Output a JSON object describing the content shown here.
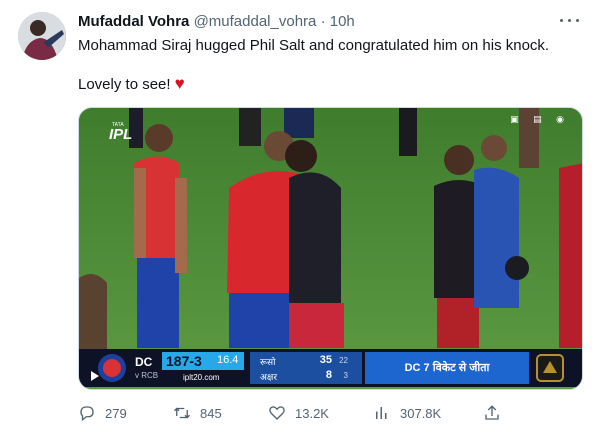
{
  "tweet": {
    "author_name": "Mufaddal Vohra",
    "handle": "@mufaddal_vohra",
    "separator": "·",
    "time": "10h",
    "line1": "Mohammad Siraj hugged Phil Salt and congratulated him on his knock.",
    "line2": "Lovely to see!",
    "heart_emoji": "♥"
  },
  "media": {
    "logo_small": "TATA",
    "logo_text": "IPL",
    "ticker": {
      "team1": "DC",
      "team2": "v RCB",
      "score": "187-3",
      "overs": "16.4",
      "site": "iplt20.com",
      "batter1": "रूसो",
      "batter1_runs": "35",
      "batter1_balls": "22",
      "batter2": "अक्षर",
      "batter2_runs": "8",
      "batter2_balls": "3",
      "result": "DC 7 विकेट से जीता"
    }
  },
  "actions": {
    "replies": "279",
    "retweets": "845",
    "likes": "13.2K",
    "views": "307.8K"
  },
  "colors": {
    "text": "#0f1419",
    "muted": "#536471",
    "heart": "#d4141f",
    "dc_blue": "#1d66d0"
  }
}
